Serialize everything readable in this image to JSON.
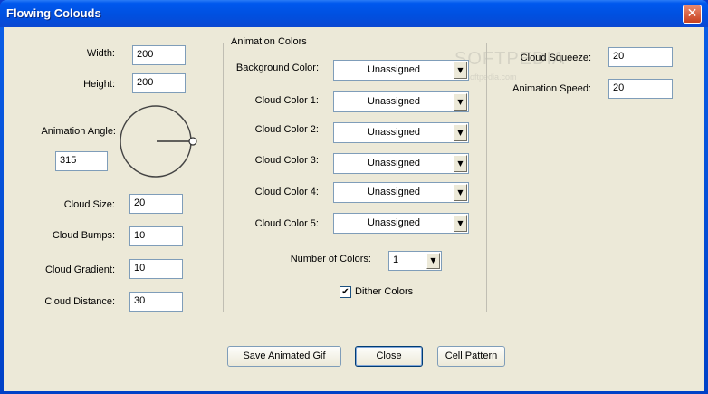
{
  "window": {
    "title": "Flowing Colouds",
    "close_glyph": "✕"
  },
  "watermark": {
    "brand": "SOFTPEDIA",
    "url": "www.softpedia.com"
  },
  "left": {
    "width_label": "Width:",
    "width_value": "200",
    "height_label": "Height:",
    "height_value": "200",
    "angle_label": "Animation Angle:",
    "angle_value": "315",
    "cloud_size_label": "Cloud Size:",
    "cloud_size_value": "20",
    "cloud_bumps_label": "Cloud Bumps:",
    "cloud_bumps_value": "10",
    "cloud_gradient_label": "Cloud Gradient:",
    "cloud_gradient_value": "10",
    "cloud_distance_label": "Cloud Distance:",
    "cloud_distance_value": "30"
  },
  "colors": {
    "group_label": "Animation Colors",
    "rows": [
      {
        "label": "Background Color:",
        "value": "Unassigned"
      },
      {
        "label": "Cloud Color 1:",
        "value": "Unassigned"
      },
      {
        "label": "Cloud Color 2:",
        "value": "Unassigned"
      },
      {
        "label": "Cloud Color 3:",
        "value": "Unassigned"
      },
      {
        "label": "Cloud Color 4:",
        "value": "Unassigned"
      },
      {
        "label": "Cloud Color 5:",
        "value": "Unassigned"
      }
    ],
    "num_colors_label": "Number of Colors:",
    "num_colors_value": "1",
    "dither_label": "Dither Colors",
    "dither_checked": true
  },
  "right": {
    "squeeze_label": "Cloud Squeeze:",
    "squeeze_value": "20",
    "speed_label": "Animation Speed:",
    "speed_value": "20"
  },
  "buttons": {
    "save": "Save Animated Gif",
    "close": "Close",
    "cell": "Cell Pattern"
  },
  "glyphs": {
    "dropdown": "▼",
    "check": "✔"
  }
}
